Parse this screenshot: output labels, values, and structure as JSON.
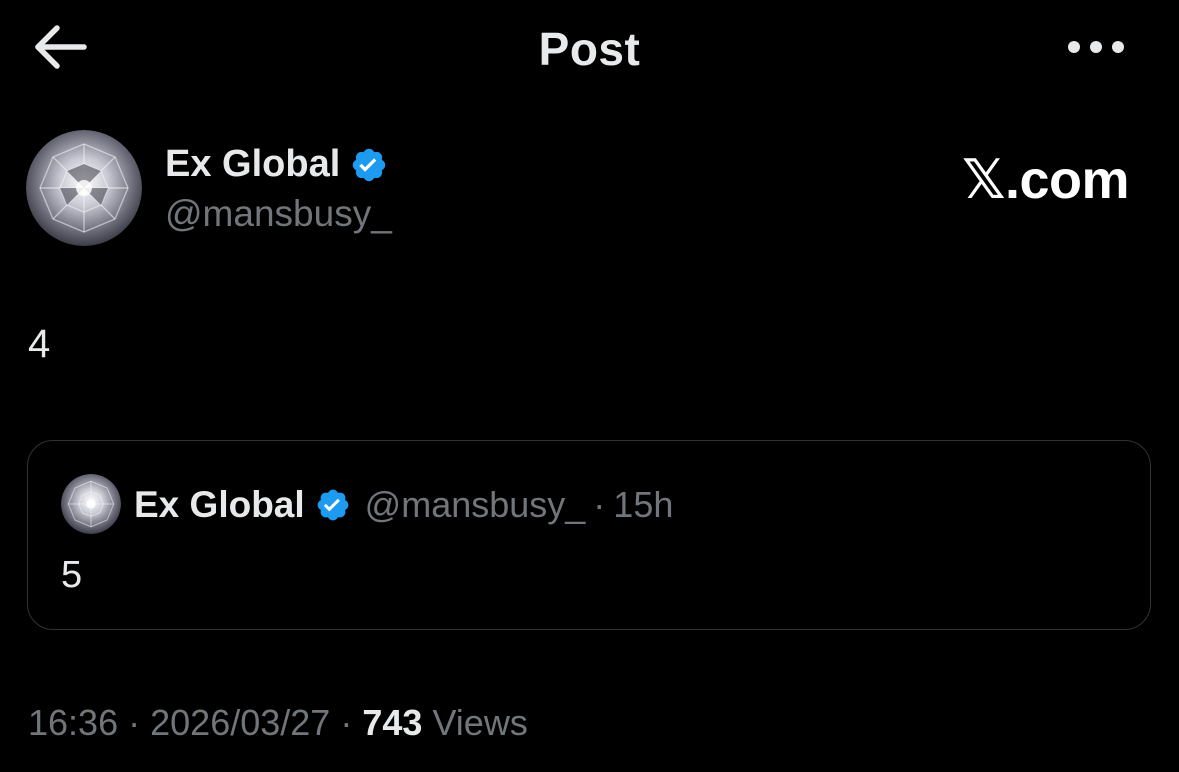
{
  "header": {
    "title": "Post",
    "back_icon": "arrow-left-icon",
    "more_icon": "more-horizontal-icon"
  },
  "post": {
    "author_name": "Ex Global",
    "author_handle": "@mansbusy_",
    "verified_color": "#1d9bf0",
    "watermark": "𝕏.com",
    "text": "4",
    "timestamp_time": "16:36",
    "timestamp_date": "2026/03/27",
    "separator": "·",
    "views_count": "743",
    "views_label": "Views"
  },
  "quoted_post": {
    "author_name": "Ex Global",
    "author_handle": "@mansbusy_",
    "separator": "·",
    "time": "15h",
    "text": "5"
  }
}
